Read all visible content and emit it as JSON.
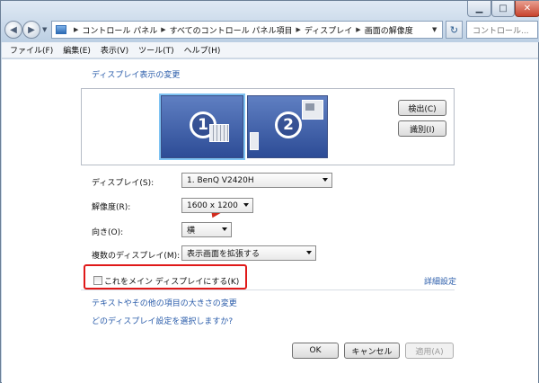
{
  "nav": {
    "back_icon": "back-arrow-icon",
    "forward_icon": "forward-arrow-icon",
    "recent_icon": "chevron-down-icon"
  },
  "address": {
    "icon": "control-panel-icon",
    "separator": "▶",
    "breadcrumbs": [
      "コントロール パネル",
      "すべてのコントロール パネル項目",
      "ディスプレイ",
      "画面の解像度"
    ],
    "refresh_icon": "refresh-icon"
  },
  "search": {
    "placeholder": "コントロール..."
  },
  "menu": {
    "items": [
      "ファイル(F)",
      "編集(E)",
      "表示(V)",
      "ツール(T)",
      "ヘルプ(H)"
    ]
  },
  "main": {
    "heading": "ディスプレイ表示の変更",
    "monitors": [
      {
        "number": "1",
        "selected": true
      },
      {
        "number": "2",
        "selected": false
      }
    ],
    "detect_button": "検出(C)",
    "identify_button": "識別(I)",
    "display_label": "ディスプレイ(S):",
    "display_value": "1. BenQ V2420H",
    "resolution_label": "解像度(R):",
    "resolution_value": "1600 x 1200",
    "orientation_label": "向き(O):",
    "orientation_value": "横",
    "multi_label": "複数のディスプレイ(M):",
    "multi_value": "表示画面を拡張する",
    "main_display_checkbox": "これをメイン ディスプレイにする(K)",
    "main_display_checked": false,
    "advanced_link": "詳細設定",
    "text_size_link": "テキストやその他の項目の大きさの変更",
    "which_settings_link": "どのディスプレイ設定を選択しますか?"
  },
  "footer": {
    "ok": "OK",
    "cancel": "キャンセル",
    "apply": "適用(A)"
  },
  "colors": {
    "link": "#2a5caa",
    "highlight": "#e01919",
    "monitor": "#3f5fa8",
    "cursor": "#d22a1c"
  }
}
